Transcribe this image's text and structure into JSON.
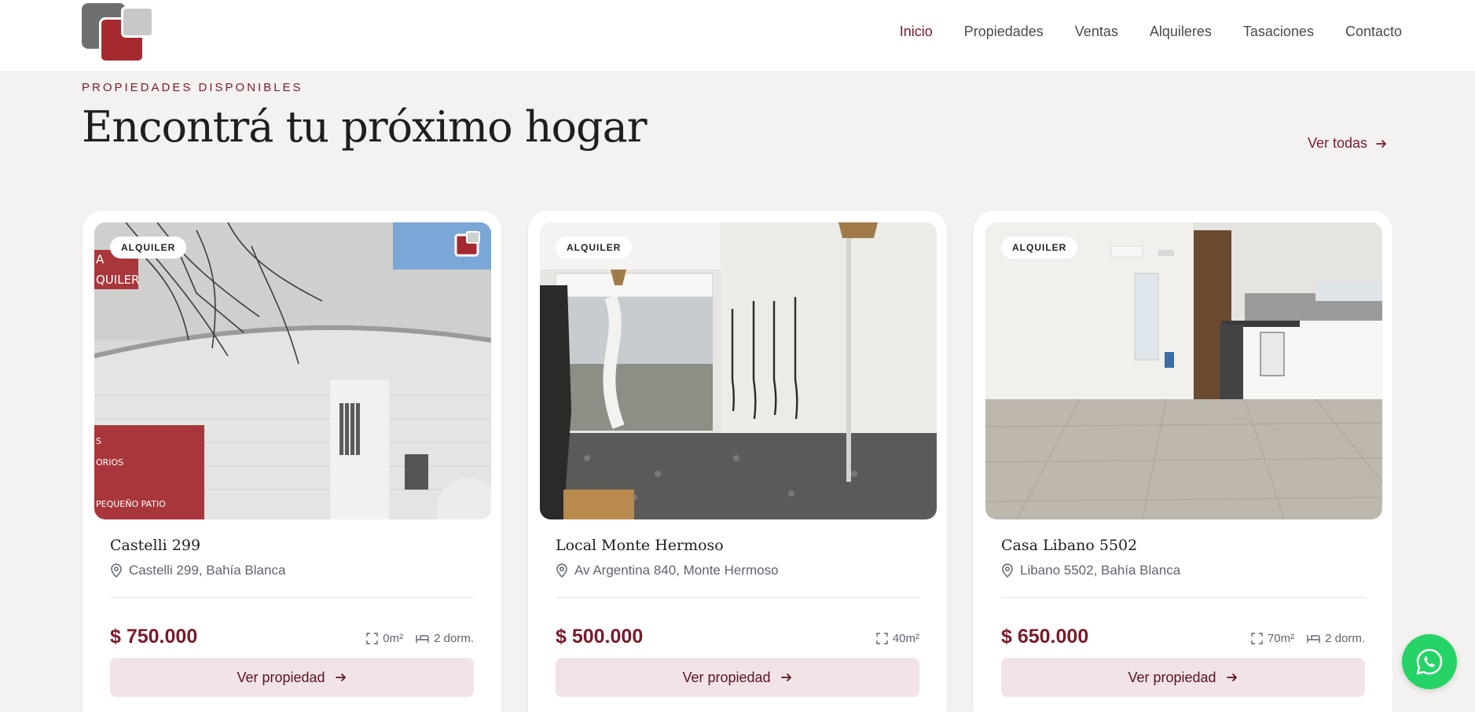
{
  "nav": {
    "items": [
      "Inicio",
      "Propiedades",
      "Ventas",
      "Alquileres",
      "Tasaciones",
      "Contacto"
    ]
  },
  "section": {
    "eyebrow": "PROPIEDADES DISPONIBLES",
    "title": "Encontrá tu próximo hogar",
    "see_all": "Ver todas"
  },
  "cards": [
    {
      "badge": "ALQUILER",
      "name": "Castelli 299",
      "address": "Castelli 299, Bahía Blanca",
      "price": "$ 750.000",
      "area": "0m²",
      "bedrooms": "2 dorm.",
      "button": "Ver propiedad",
      "sign_text_top": "A\nQUILER",
      "sign_text_bottom": "S\nORIOS\n\nPEQUEÑO PATIO"
    },
    {
      "badge": "ALQUILER",
      "name": "Local Monte Hermoso",
      "address": "Av Argentina 840, Monte Hermoso",
      "price": "$ 500.000",
      "area": "40m²",
      "button": "Ver propiedad"
    },
    {
      "badge": "ALQUILER",
      "name": "Casa Libano 5502",
      "address": "Libano 5502, Bahía Blanca",
      "price": "$ 650.000",
      "area": "70m²",
      "bedrooms": "2 dorm.",
      "button": "Ver propiedad"
    }
  ],
  "colors": {
    "accent": "#7a1b2a",
    "button_bg": "#f2e3e6",
    "whatsapp": "#25d366"
  }
}
